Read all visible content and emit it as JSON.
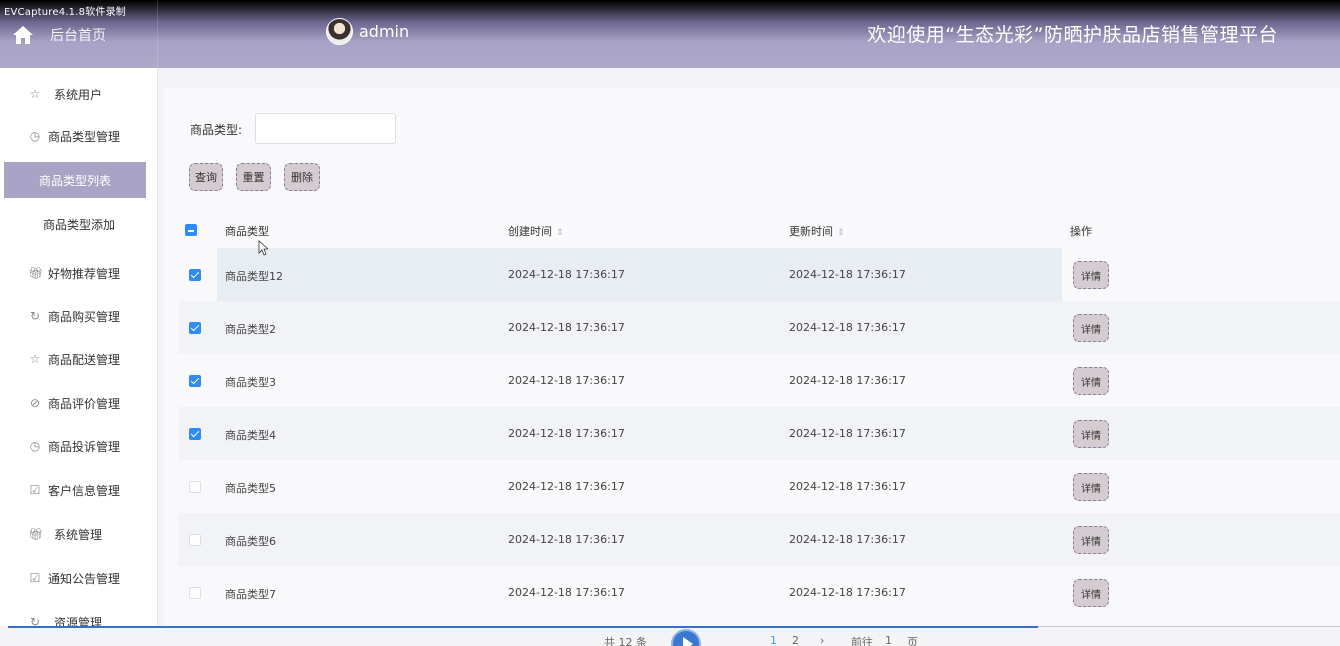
{
  "recorder": {
    "label": "EVCapture4.1.8软件录制"
  },
  "header": {
    "home_label": "后台首页",
    "user": "admin",
    "title": "欢迎使用“生态光彩”防晒护肤品店销售管理平台"
  },
  "sidebar": {
    "items": [
      {
        "label": "系统用户",
        "icon": "star-icon"
      },
      {
        "label": "商品类型管理",
        "icon": "clock-icon"
      },
      {
        "label": "商品类型列表",
        "active": true
      },
      {
        "label": "商品类型添加"
      },
      {
        "label": "好物推荐管理",
        "icon": "gift-icon"
      },
      {
        "label": "商品购买管理",
        "icon": "refresh-icon"
      },
      {
        "label": "商品配送管理",
        "icon": "star-icon"
      },
      {
        "label": "商品评价管理",
        "icon": "compass-icon"
      },
      {
        "label": "商品投诉管理",
        "icon": "clock-icon"
      },
      {
        "label": "客户信息管理",
        "icon": "calendar-icon"
      },
      {
        "label": "系统管理",
        "icon": "gift-icon"
      },
      {
        "label": "通知公告管理",
        "icon": "calendar-icon"
      },
      {
        "label": "资源管理",
        "icon": "refresh-icon"
      }
    ]
  },
  "filter": {
    "label": "商品类型:",
    "value": ""
  },
  "buttons": {
    "search": "查询",
    "reset": "重置",
    "delete": "删除"
  },
  "table": {
    "headers": {
      "type": "商品类型",
      "created": "创建时间",
      "updated": "更新时间",
      "ops": "操作"
    },
    "detail_label": "详情",
    "rows": [
      {
        "type": "商品类型12",
        "created": "2024-12-18 17:36:17",
        "updated": "2024-12-18 17:36:17",
        "checked": true
      },
      {
        "type": "商品类型2",
        "created": "2024-12-18 17:36:17",
        "updated": "2024-12-18 17:36:17",
        "checked": true
      },
      {
        "type": "商品类型3",
        "created": "2024-12-18 17:36:17",
        "updated": "2024-12-18 17:36:17",
        "checked": true
      },
      {
        "type": "商品类型4",
        "created": "2024-12-18 17:36:17",
        "updated": "2024-12-18 17:36:17",
        "checked": true
      },
      {
        "type": "商品类型5",
        "created": "2024-12-18 17:36:17",
        "updated": "2024-12-18 17:36:17",
        "checked": false
      },
      {
        "type": "商品类型6",
        "created": "2024-12-18 17:36:17",
        "updated": "2024-12-18 17:36:17",
        "checked": false
      },
      {
        "type": "商品类型7",
        "created": "2024-12-18 17:36:17",
        "updated": "2024-12-18 17:36:17",
        "checked": false
      }
    ]
  },
  "pager": {
    "total": "共 12 条",
    "page1": "1",
    "page2": "2",
    "goto": "前往",
    "goto_value": "1",
    "page_unit": "页"
  },
  "colors": {
    "accent": "#a9a3c5",
    "checkbox": "#2f8cf2",
    "button_bg": "#d5ccd1"
  }
}
